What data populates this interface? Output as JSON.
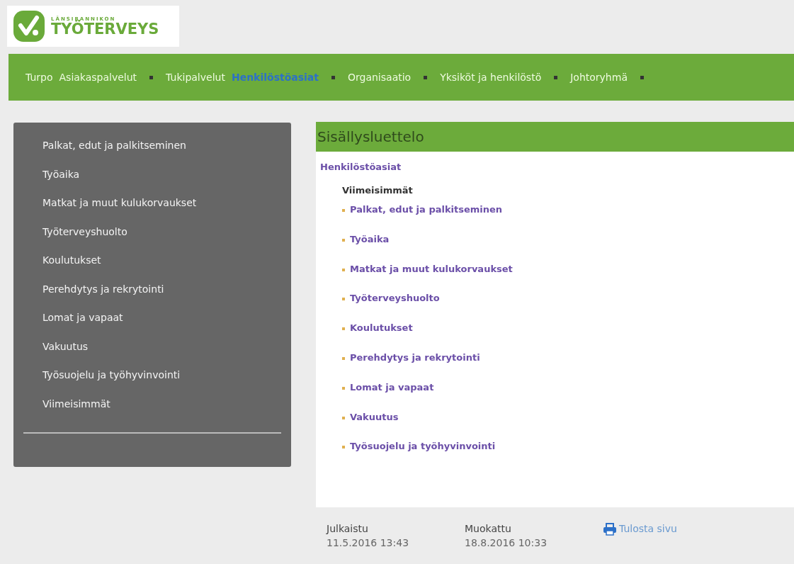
{
  "logo": {
    "subtitle": "LÄNSIRANNIKON",
    "title": "TYÖTERVEYS"
  },
  "nav": [
    {
      "label": "Turpo",
      "selected": false,
      "has_menu": false
    },
    {
      "label": "Asiakaspalvelut",
      "selected": false,
      "has_menu": true
    },
    {
      "label": "Tukipalvelut",
      "selected": false,
      "has_menu": false
    },
    {
      "label": "Henkilöstöasiat",
      "selected": true,
      "has_menu": true
    },
    {
      "label": "Organisaatio",
      "selected": false,
      "has_menu": true
    },
    {
      "label": "Yksiköt ja henkilöstö",
      "selected": false,
      "has_menu": true
    },
    {
      "label": "Johtoryhmä",
      "selected": false,
      "has_menu": true
    }
  ],
  "sidebar": {
    "items": [
      "Palkat, edut ja palkitseminen",
      "Työaika",
      "Matkat ja muut kulukorvaukset",
      "Työterveyshuolto",
      "Koulutukset",
      "Perehdytys ja rekrytointi",
      "Lomat ja vapaat",
      "Vakuutus",
      "Työsuojelu ja työhyvinvointi",
      "Viimeisimmät"
    ]
  },
  "content": {
    "heading": "Sisällysluettelo",
    "section": "Henkilöstöasiat",
    "subheading": "Viimeisimmät",
    "links": [
      "Palkat, edut ja palkitseminen",
      "Työaika",
      "Matkat ja muut kulukorvaukset",
      "Työterveyshuolto",
      "Koulutukset",
      "Perehdytys ja rekrytointi",
      "Lomat ja vapaat",
      "Vakuutus",
      "Työsuojelu ja työhyvinvointi"
    ]
  },
  "footer": {
    "published_label": "Julkaistu",
    "published": "11.5.2016 13:43",
    "modified_label": "Muokattu",
    "modified": "18.8.2016 10:33",
    "print": "Tulosta sivu"
  }
}
